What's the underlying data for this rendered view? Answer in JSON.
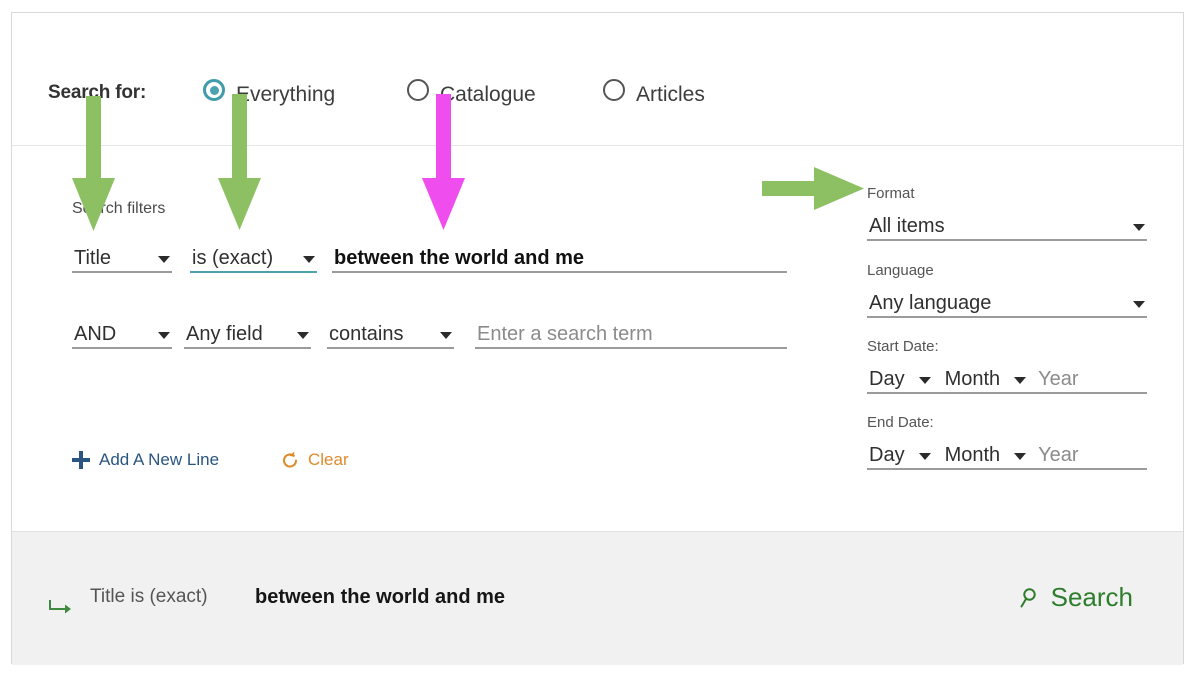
{
  "search_for": {
    "label": "Search for:",
    "options": [
      {
        "label": "Everything",
        "selected": true
      },
      {
        "label": "Catalogue",
        "selected": false
      },
      {
        "label": "Articles",
        "selected": false
      }
    ]
  },
  "filters": {
    "heading": "Search filters",
    "rows": [
      {
        "field": "Title",
        "operator": "is (exact)",
        "value": "between the world and me",
        "placeholder": ""
      },
      {
        "boolean": "AND",
        "field": "Any field",
        "operator": "contains",
        "value": "",
        "placeholder": "Enter a search term"
      }
    ],
    "actions": {
      "add_line": "Add A New Line",
      "clear": "Clear"
    }
  },
  "facets": {
    "format": {
      "label": "Format",
      "value": "All items"
    },
    "language": {
      "label": "Language",
      "value": "Any language"
    },
    "start_date": {
      "label": "Start Date:",
      "day": "Day",
      "month": "Month",
      "year_placeholder": "Year"
    },
    "end_date": {
      "label": "End Date:",
      "day": "Day",
      "month": "Month",
      "year_placeholder": "Year"
    }
  },
  "summary": {
    "field_operator": "Title  is (exact)",
    "value": "between the world and me",
    "search_button": "Search"
  },
  "colors": {
    "green_arrow": "#8dc063",
    "magenta_arrow": "#ef4ded",
    "accent_teal": "#4ba3ae",
    "link_blue": "#2a5580",
    "clear_orange": "#e08a2e",
    "search_green": "#2d7d2d"
  }
}
